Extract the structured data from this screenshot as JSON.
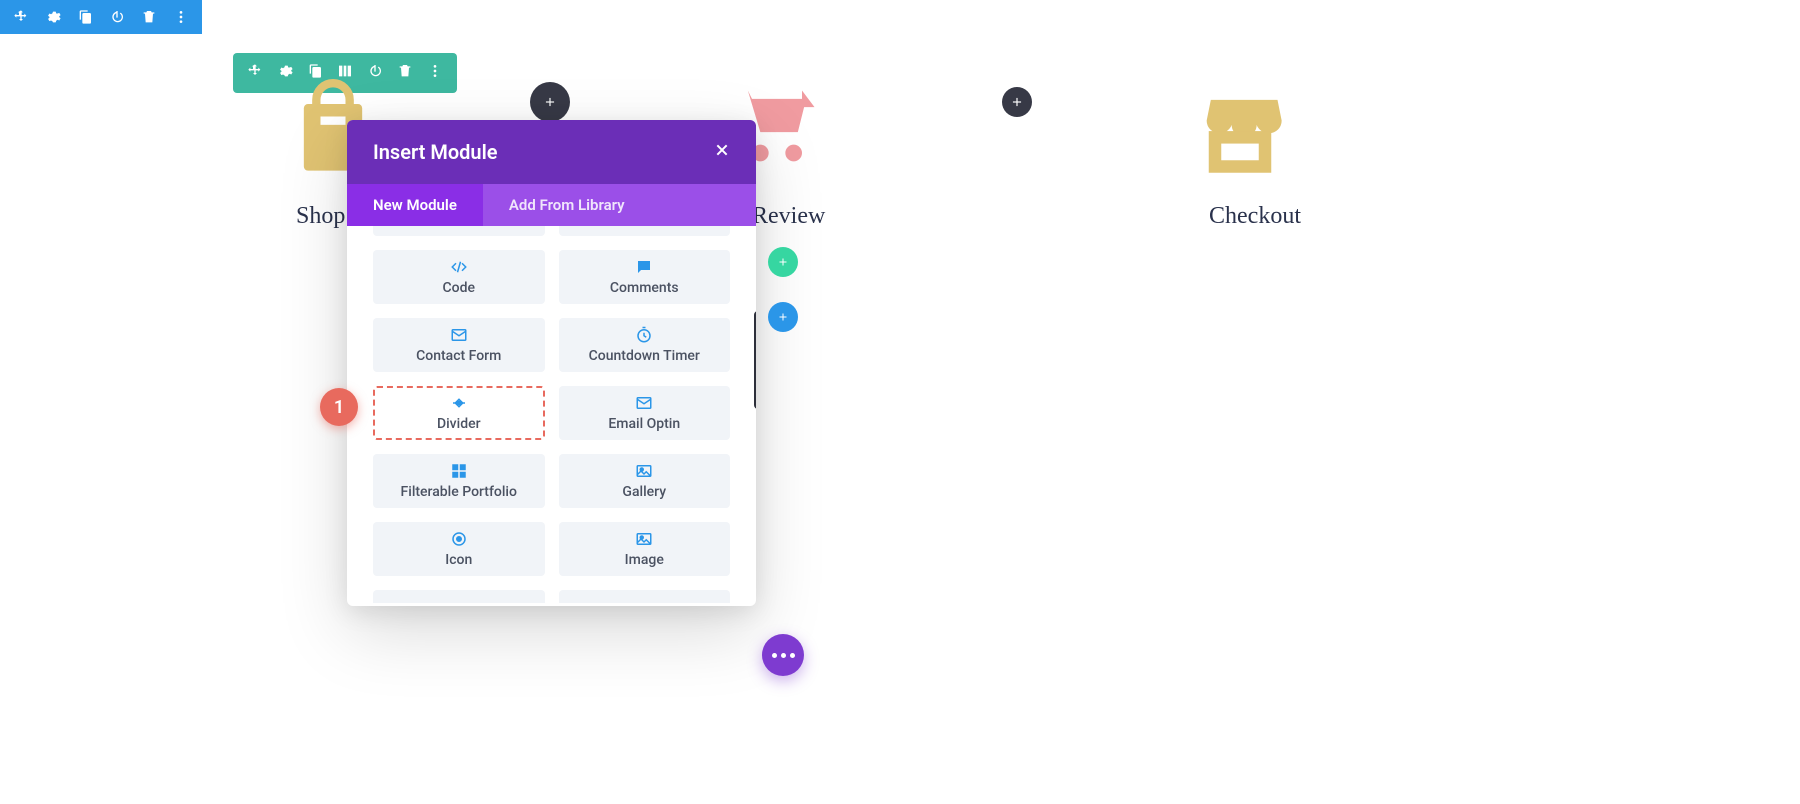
{
  "columns": {
    "shop": {
      "label": "Shop"
    },
    "review": {
      "label": "Review"
    },
    "checkout": {
      "label": "Checkout"
    }
  },
  "modal": {
    "title": "Insert Module",
    "tabs": {
      "new": "New Module",
      "library": "Add From Library"
    },
    "modules": {
      "code": "Code",
      "comments": "Comments",
      "contact_form": "Contact Form",
      "countdown_timer": "Countdown Timer",
      "divider": "Divider",
      "email_optin": "Email Optin",
      "filterable_portfolio": "Filterable Portfolio",
      "gallery": "Gallery",
      "icon": "Icon",
      "image": "Image"
    }
  },
  "callout": {
    "number": "1"
  },
  "colors": {
    "section_toolbar": "#2b96e8",
    "row_toolbar": "#3eb8a0",
    "modal_header": "#6b2eb7",
    "modal_tab_active": "#8a2ee6",
    "callout": "#e86a5e",
    "icon_tan": "#e0c372",
    "icon_pink": "#f09ba0"
  }
}
